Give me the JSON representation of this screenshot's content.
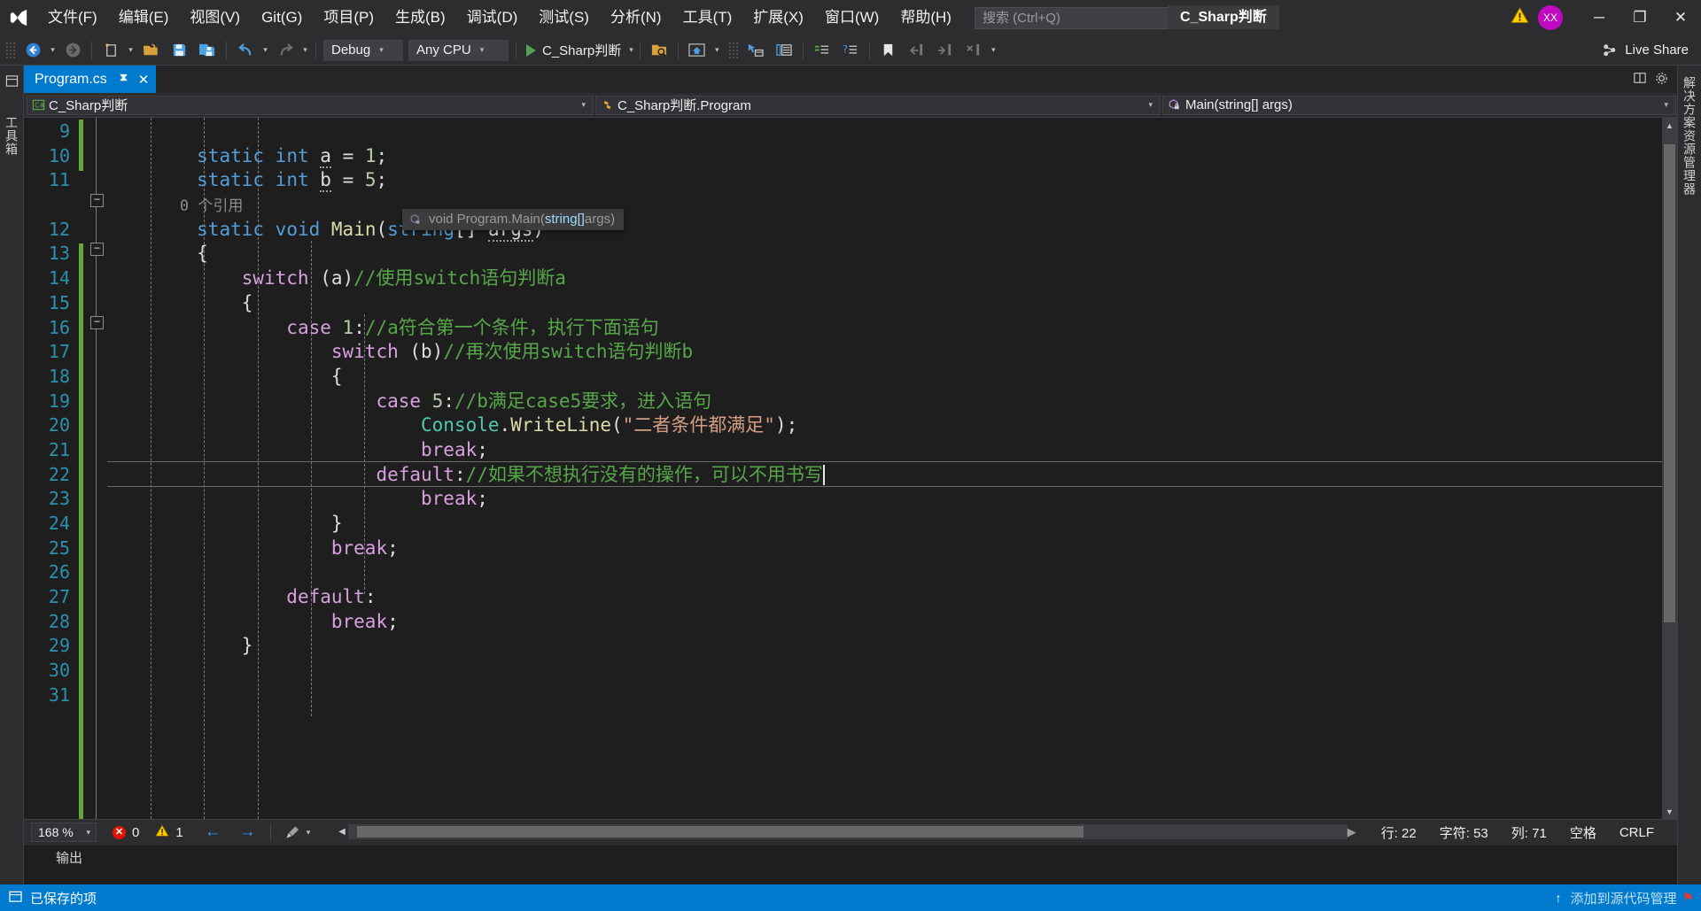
{
  "window": {
    "project_chip": "C_Sharp判断",
    "minimize_label": "─",
    "maximize_label": "❐",
    "close_label": "✕",
    "avatar_initials": "XX"
  },
  "menu": {
    "items": [
      {
        "label": "文件(F)"
      },
      {
        "label": "编辑(E)"
      },
      {
        "label": "视图(V)"
      },
      {
        "label": "Git(G)"
      },
      {
        "label": "项目(P)"
      },
      {
        "label": "生成(B)"
      },
      {
        "label": "调试(D)"
      },
      {
        "label": "测试(S)"
      },
      {
        "label": "分析(N)"
      },
      {
        "label": "工具(T)"
      },
      {
        "label": "扩展(X)"
      },
      {
        "label": "窗口(W)"
      },
      {
        "label": "帮助(H)"
      }
    ]
  },
  "search": {
    "placeholder": "搜索 (Ctrl+Q)",
    "value": "",
    "icon": "search-icon"
  },
  "toolbar": {
    "config_value": "Debug",
    "platform_value": "Any CPU",
    "run_target": "C_Sharp判断",
    "live_share": "Live Share",
    "caret": "▾",
    "icons": [
      "navigate-back-icon",
      "navigate-forward-icon",
      "new-item-icon",
      "open-file-icon",
      "save-icon",
      "save-all-icon",
      "undo-icon",
      "redo-icon",
      "start-debug-icon",
      "search-in-files-icon",
      "solution-explorer-home-icon",
      "properties-window-icon",
      "toolbox-icon",
      "comment-icon",
      "uncomment-icon",
      "bookmark-icon",
      "prev-bookmark-icon",
      "next-bookmark-icon",
      "clear-bookmarks-icon"
    ]
  },
  "left_rail": {
    "label": "工具箱"
  },
  "right_rail": {
    "label": "解决方案资源管理器"
  },
  "tabs": [
    {
      "label": "Program.cs",
      "pin_icon": "pin-icon",
      "close_icon": "close-icon",
      "active": true
    }
  ],
  "tabstrip_right": {
    "split_icon": "split-window-icon",
    "settings_icon": "gear-icon"
  },
  "navbar": {
    "project": "C_Sharp判断",
    "type": "C_Sharp判断.Program",
    "member": "Main(string[] args)",
    "project_icon": "csharp-project-icon",
    "type_icon": "class-icon",
    "member_icon": "method-icon",
    "arrow": "▾",
    "plus_icon": "add-icon"
  },
  "tooltip": {
    "icon": "method-private-icon",
    "prefix": "void Program.",
    "method": "Main",
    "open_paren": "(",
    "param_type": "string[] ",
    "param_name": "args",
    "close_paren": ")"
  },
  "editor": {
    "first_visible_line": 9,
    "line_numbers": [
      9,
      10,
      11,
      "",
      12,
      13,
      14,
      15,
      16,
      17,
      18,
      19,
      20,
      21,
      22,
      23,
      24,
      25,
      26,
      27,
      28,
      29,
      30,
      31
    ],
    "caret_line": 22,
    "lines": [
      {
        "n": 9,
        "tokens": []
      },
      {
        "n": 10,
        "tokens": [
          {
            "t": "        ",
            "c": "plain"
          },
          {
            "t": "static",
            "c": "kw"
          },
          {
            "t": " ",
            "c": "plain"
          },
          {
            "t": "int",
            "c": "kw"
          },
          {
            "t": " ",
            "c": "plain"
          },
          {
            "t": "a",
            "c": "var-sq"
          },
          {
            "t": " = ",
            "c": "plain"
          },
          {
            "t": "1",
            "c": "num"
          },
          {
            "t": ";",
            "c": "plain"
          }
        ]
      },
      {
        "n": 11,
        "tokens": [
          {
            "t": "        ",
            "c": "plain"
          },
          {
            "t": "static",
            "c": "kw"
          },
          {
            "t": " ",
            "c": "plain"
          },
          {
            "t": "int",
            "c": "kw"
          },
          {
            "t": " ",
            "c": "plain"
          },
          {
            "t": "b",
            "c": "var-sq"
          },
          {
            "t": " = ",
            "c": "plain"
          },
          {
            "t": "5",
            "c": "num"
          },
          {
            "t": ";",
            "c": "plain"
          }
        ]
      },
      {
        "n": "",
        "tokens": [
          {
            "t": "        0 个引用",
            "c": "ref"
          }
        ]
      },
      {
        "n": 12,
        "tokens": [
          {
            "t": "        ",
            "c": "plain"
          },
          {
            "t": "static",
            "c": "kw"
          },
          {
            "t": " ",
            "c": "plain"
          },
          {
            "t": "void",
            "c": "kw"
          },
          {
            "t": " ",
            "c": "plain"
          },
          {
            "t": "Main",
            "c": "mth"
          },
          {
            "t": "(",
            "c": "plain"
          },
          {
            "t": "string",
            "c": "kw"
          },
          {
            "t": "[] ",
            "c": "plain"
          },
          {
            "t": "args",
            "c": "var-sq"
          },
          {
            "t": ")",
            "c": "plain"
          }
        ]
      },
      {
        "n": 13,
        "tokens": [
          {
            "t": "        {",
            "c": "plain"
          }
        ]
      },
      {
        "n": 14,
        "tokens": [
          {
            "t": "            ",
            "c": "plain"
          },
          {
            "t": "switch",
            "c": "ctl"
          },
          {
            "t": " (a)",
            "c": "plain"
          },
          {
            "t": "//使用switch语句判断a",
            "c": "cmt"
          }
        ]
      },
      {
        "n": 15,
        "tokens": [
          {
            "t": "            {",
            "c": "plain"
          }
        ]
      },
      {
        "n": 16,
        "tokens": [
          {
            "t": "                ",
            "c": "plain"
          },
          {
            "t": "case",
            "c": "ctl"
          },
          {
            "t": " ",
            "c": "plain"
          },
          {
            "t": "1",
            "c": "num"
          },
          {
            "t": ":",
            "c": "plain"
          },
          {
            "t": "//a符合第一个条件，执行下面语句",
            "c": "cmt"
          }
        ]
      },
      {
        "n": 17,
        "tokens": [
          {
            "t": "                    ",
            "c": "plain"
          },
          {
            "t": "switch",
            "c": "ctl"
          },
          {
            "t": " (b)",
            "c": "plain"
          },
          {
            "t": "//再次使用switch语句判断b",
            "c": "cmt"
          }
        ]
      },
      {
        "n": 18,
        "tokens": [
          {
            "t": "                    {",
            "c": "plain"
          }
        ]
      },
      {
        "n": 19,
        "tokens": [
          {
            "t": "                        ",
            "c": "plain"
          },
          {
            "t": "case",
            "c": "ctl"
          },
          {
            "t": " ",
            "c": "plain"
          },
          {
            "t": "5",
            "c": "num"
          },
          {
            "t": ":",
            "c": "plain"
          },
          {
            "t": "//b满足case5要求，进入语句",
            "c": "cmt"
          }
        ]
      },
      {
        "n": 20,
        "tokens": [
          {
            "t": "                            ",
            "c": "plain"
          },
          {
            "t": "Console",
            "c": "typ"
          },
          {
            "t": ".",
            "c": "plain"
          },
          {
            "t": "WriteLine",
            "c": "mth"
          },
          {
            "t": "(",
            "c": "plain"
          },
          {
            "t": "\"二者条件都满足\"",
            "c": "str"
          },
          {
            "t": ");",
            "c": "plain"
          }
        ]
      },
      {
        "n": 21,
        "tokens": [
          {
            "t": "                            ",
            "c": "plain"
          },
          {
            "t": "break",
            "c": "ctl"
          },
          {
            "t": ";",
            "c": "plain"
          }
        ]
      },
      {
        "n": 22,
        "tokens": [
          {
            "t": "                        ",
            "c": "plain"
          },
          {
            "t": "default",
            "c": "ctl"
          },
          {
            "t": ":",
            "c": "plain"
          },
          {
            "t": "//如果不想执行没有的操作，可以不用书写",
            "c": "cmt"
          }
        ]
      },
      {
        "n": 23,
        "tokens": [
          {
            "t": "                            ",
            "c": "plain"
          },
          {
            "t": "break",
            "c": "ctl"
          },
          {
            "t": ";",
            "c": "plain"
          }
        ]
      },
      {
        "n": 24,
        "tokens": [
          {
            "t": "                    }",
            "c": "plain"
          }
        ]
      },
      {
        "n": 25,
        "tokens": [
          {
            "t": "                    ",
            "c": "plain"
          },
          {
            "t": "break",
            "c": "ctl"
          },
          {
            "t": ";",
            "c": "plain"
          }
        ]
      },
      {
        "n": 26,
        "tokens": []
      },
      {
        "n": 27,
        "tokens": [
          {
            "t": "                ",
            "c": "plain"
          },
          {
            "t": "default",
            "c": "ctl"
          },
          {
            "t": ":",
            "c": "plain"
          }
        ]
      },
      {
        "n": 28,
        "tokens": [
          {
            "t": "                    ",
            "c": "plain"
          },
          {
            "t": "break",
            "c": "ctl"
          },
          {
            "t": ";",
            "c": "plain"
          }
        ]
      },
      {
        "n": 29,
        "tokens": [
          {
            "t": "            }",
            "c": "plain"
          }
        ]
      },
      {
        "n": 30,
        "tokens": []
      },
      {
        "n": 31,
        "tokens": []
      }
    ]
  },
  "editor_status": {
    "zoom": "168 %",
    "zoom_arrow": "▾",
    "errors": "0",
    "warnings": "1",
    "error_icon": "error-icon",
    "warning_icon": "warning-icon",
    "prev_icon": "←",
    "next_icon": "→",
    "brush_icon": "formatting-icon",
    "line_label": "行: 22",
    "char_label": "字符: 53",
    "col_label": "列: 71",
    "space_label": "空格",
    "eol_label": "CRLF"
  },
  "output": {
    "title": "输出"
  },
  "statusbar": {
    "saved_icon": "saved-icon",
    "saved_label": "已保存的项",
    "up_icon": "↑",
    "watermark": "添加到源代码管理",
    "flag_icon": "flag-icon"
  }
}
